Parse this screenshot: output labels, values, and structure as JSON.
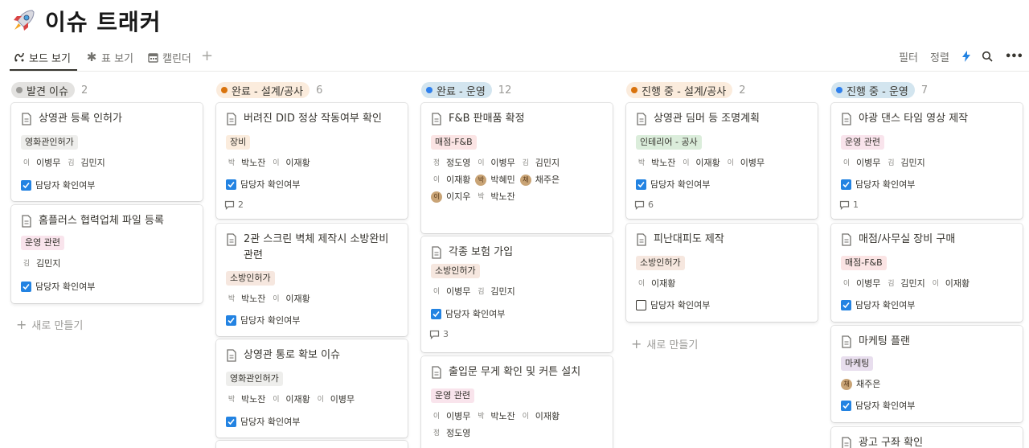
{
  "page": {
    "title": "이슈 트래커",
    "icon": "rocket-icon"
  },
  "views": [
    {
      "label": "보드 보기",
      "icon": "board-icon"
    },
    {
      "label": "표 보기",
      "icon": "asterisk-icon"
    },
    {
      "label": "캘린더",
      "icon": "calendar-icon"
    }
  ],
  "toolbar": {
    "filter": "필터",
    "sort": "정렬"
  },
  "colors": {
    "checkbox": "#2383e2",
    "gray_dot": "#9b9a97",
    "orange_dot": "#d9730d",
    "blue_dot": "#2f80ed"
  },
  "columns": [
    {
      "status": "발견 이슈",
      "count": "2",
      "cards": [
        {
          "title": "상영관 등록 인허가",
          "tag": "영화관인허가",
          "people": [
            [
              "이",
              "이병무"
            ],
            [
              "김",
              "김민지"
            ]
          ],
          "check": "담당자 확인여부"
        },
        {
          "title": "홈플러스 협력업체 파일 등록",
          "tag": "운영 관련",
          "people": [
            [
              "김",
              "김민지"
            ]
          ],
          "check": "담당자 확인여부"
        }
      ],
      "new_label": "새로 만들기"
    },
    {
      "status": "완료 - 설계/공사",
      "count": "6",
      "cards": [
        {
          "title": "버려진 DID 정상 작동여부 확인",
          "tag": "장비",
          "people": [
            [
              "박",
              "박노잔"
            ],
            [
              "이",
              "이재황"
            ]
          ],
          "check": "담당자 확인여부",
          "comments": "2"
        },
        {
          "title": "2관 스크린 벽체 제작시 소방완비 관련",
          "tag": "소방인허가",
          "people": [
            [
              "박",
              "박노잔"
            ],
            [
              "이",
              "이재황"
            ]
          ],
          "check": "담당자 확인여부"
        },
        {
          "title": "상영관 통로 확보 이슈",
          "tag": "영화관인허가",
          "people": [
            [
              "박",
              "박노잔"
            ],
            [
              "이",
              "이재황"
            ],
            [
              "이",
              "이병무"
            ]
          ],
          "check": "담당자 확인여부"
        }
      ]
    },
    {
      "status": "완료 - 운영",
      "count": "12",
      "cards": [
        {
          "title": "F&B 판매품 확정",
          "tag": "매점-F&B",
          "people": [
            [
              "정",
              "정도영"
            ],
            [
              "이",
              "이병무"
            ],
            [
              "김",
              "김민지"
            ],
            [
              "이",
              "이재황"
            ],
            [
              "박",
              "박혜민"
            ],
            [
              "채",
              "채주은"
            ],
            [
              "이",
              "이지우"
            ],
            [
              "박",
              "박노잔"
            ]
          ],
          "check": "담당자 확인여부"
        },
        {
          "title": "각종 보험 가입",
          "tag": "소방인허가",
          "people": [
            [
              "이",
              "이병무"
            ],
            [
              "김",
              "김민지"
            ]
          ],
          "check": "담당자 확인여부",
          "comments": "3"
        },
        {
          "title": "출입문 무게 확인 및 커튼 설치",
          "tag": "운영 관련",
          "people": [
            [
              "이",
              "이병무"
            ],
            [
              "박",
              "박노잔"
            ],
            [
              "이",
              "이재황"
            ],
            [
              "정",
              "정도영"
            ]
          ]
        }
      ]
    },
    {
      "status": "진행 중 - 설계/공사",
      "count": "2",
      "cards": [
        {
          "title": "상영관 딤머 등 조명계획",
          "tag": "인테리어 - 공사",
          "people": [
            [
              "박",
              "박노잔"
            ],
            [
              "이",
              "이재황"
            ],
            [
              "이",
              "이병무"
            ]
          ],
          "check": "담당자 확인여부",
          "comments": "6"
        },
        {
          "title": "피난대피도 제작",
          "tag": "소방인허가",
          "people": [
            [
              "이",
              "이재황"
            ]
          ],
          "check": "담당자 확인여부"
        }
      ],
      "new_label": "새로 만들기"
    },
    {
      "status": "진행 중 - 운영",
      "count": "7",
      "cards": [
        {
          "title": "야광 댄스 타임 영상 제작",
          "tag": "운영 관련",
          "people": [
            [
              "이",
              "이병무"
            ],
            [
              "김",
              "김민지"
            ]
          ],
          "check": "담당자 확인여부",
          "comments": "1"
        },
        {
          "title": "매점/사무실 장비 구매",
          "tag": "매점-F&B",
          "people": [
            [
              "이",
              "이병무"
            ],
            [
              "김",
              "김민지"
            ],
            [
              "이",
              "이재황"
            ]
          ],
          "check": "담당자 확인여부"
        },
        {
          "title": "마케팅 플랜",
          "tag": "마케팅",
          "people": [
            [
              "채",
              "채주은"
            ]
          ],
          "check": "담당자 확인여부"
        },
        {
          "title": "광고 구좌 확인"
        }
      ]
    }
  ]
}
